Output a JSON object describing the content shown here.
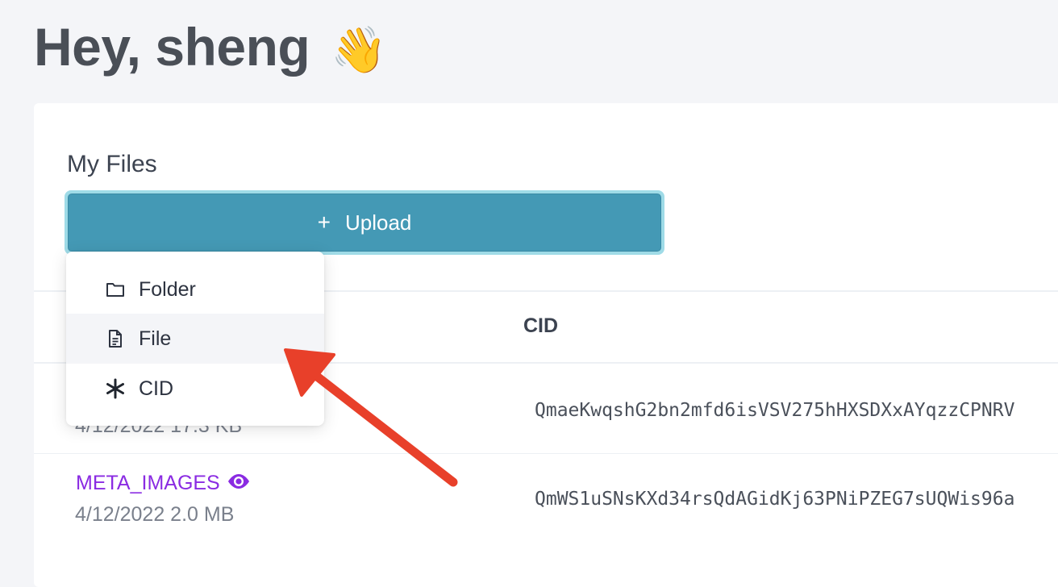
{
  "header": {
    "greeting": "Hey, sheng",
    "wave_emoji": "👋"
  },
  "files": {
    "title": "My Files",
    "upload_button": {
      "icon": "+",
      "label": "Upload"
    },
    "upload_menu": [
      {
        "label": "Folder",
        "icon": "folder-icon"
      },
      {
        "label": "File",
        "icon": "file-icon"
      },
      {
        "label": "CID",
        "icon": "asterisk-icon"
      }
    ],
    "columns": {
      "cid": "CID"
    },
    "rows": [
      {
        "name": "",
        "meta": "4/12/2022 17.3 KB",
        "cid": "QmaeKwqshG2bn2mfd6isVSV275hHXSDXxAYqzzCPNRV"
      },
      {
        "name": "META_IMAGES",
        "meta": "4/12/2022 2.0 MB",
        "cid": "QmWS1uSNsKXd34rsQdAGidKj63PNiPZEG7sUQWis96a"
      }
    ]
  },
  "colors": {
    "accent": "#4499b5",
    "link": "#8a2be2",
    "annotation_arrow": "#e8402a"
  }
}
